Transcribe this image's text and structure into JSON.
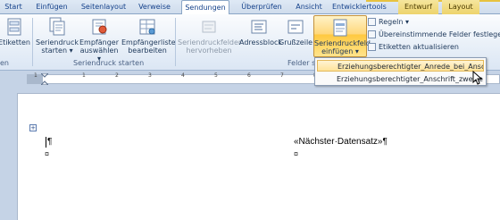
{
  "tabs": [
    {
      "label": "Start",
      "active": false
    },
    {
      "label": "Einfügen",
      "active": false
    },
    {
      "label": "Seitenlayout",
      "active": false
    },
    {
      "label": "Verweise",
      "active": false
    },
    {
      "label": "Sendungen",
      "active": true
    },
    {
      "label": "Überprüfen",
      "active": false
    },
    {
      "label": "Ansicht",
      "active": false
    },
    {
      "label": "Entwicklertools",
      "active": false
    },
    {
      "label": "Entwurf",
      "active": false
    },
    {
      "label": "Layout",
      "active": false
    }
  ],
  "ribbon": {
    "etiketten": "Etiketten",
    "seriendruck_starten": "Seriendruck starten",
    "empfaenger_auswaehlen": "Empfänger auswählen",
    "empfaengerliste_bearbeiten": "Empfängerliste bearbeiten",
    "group_seriendruck_starten": "Seriendruck starten",
    "seriendruckfelder_hervorheben": "Seriendruckfelder hervorheben",
    "adressblock": "Adressblock",
    "grusszeile": "Grußzeile",
    "seriendruckfeld_einfuegen": "Seriendruckfeld einfügen",
    "regeln": "Regeln",
    "uebereinstimmende_felder": "Übereinstimmende Felder festlegen",
    "etiketten_aktualisieren": "Etiketten aktualisieren",
    "group_felder": "Felder s",
    "group_left_partial": "en"
  },
  "dropdown": {
    "items": [
      "Erziehungsberechtigter_Anrede_bei_Ansch",
      "Erziehungsberechtigter_Anschrift_zweize"
    ]
  },
  "ruler": {
    "numbers": [
      "1",
      "1",
      "2",
      "3",
      "4",
      "5",
      "6",
      "7",
      "8",
      "9",
      "10",
      "11",
      "12",
      "13"
    ]
  },
  "document": {
    "cell_left_mark": "¶",
    "cell_left_end": "¤",
    "next_record": "«Nächster·Datensatz»¶",
    "cell_right_end": "¤",
    "table_handle": "+"
  },
  "colors": {
    "ribbon_text": "#1e395b",
    "highlight": "#ffe39a",
    "context_tab": "#edd36c"
  }
}
